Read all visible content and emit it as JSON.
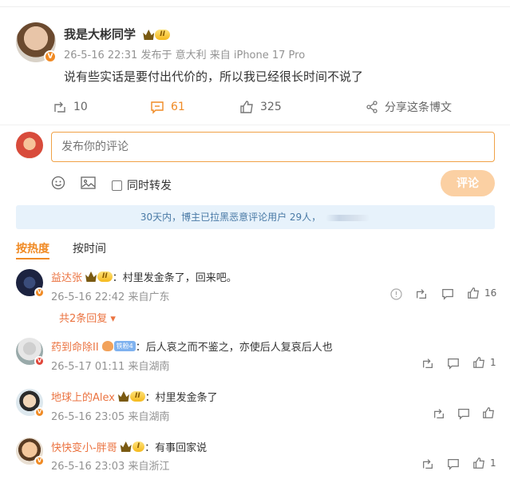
{
  "post": {
    "author": "我是大彬同学",
    "level": "II",
    "meta": "26-5-16 22:31  发布于 意大利  来自 iPhone 17 Pro",
    "text": "说有些实话是要付出代价的，所以我已经很长时间不说了",
    "reposts": "10",
    "comments": "61",
    "likes": "325",
    "share_label": "分享这条博文"
  },
  "compose": {
    "placeholder": "发布你的评论",
    "repost_label": "同时转发",
    "submit_label": "评论"
  },
  "notice": "30天内，博主已拉黑恶意评论用户 29人，",
  "sort": {
    "hot": "按热度",
    "time": "按时间"
  },
  "comments": [
    {
      "user": "益达张",
      "level": "II",
      "text": "：村里发金条了，回来吧。",
      "meta": "26-5-16 22:42  来自广东",
      "likes": "16",
      "replies": "共2条回复"
    },
    {
      "user": "药到命除II",
      "fan_level": "铁粉4",
      "text": "：后人哀之而不鉴之，亦使后人复哀后人也",
      "meta": "26-5-17 01:11  来自湖南",
      "likes": "1"
    },
    {
      "user": "地球上的Alex",
      "level": "II",
      "text": "：村里发金条了",
      "meta": "26-5-16 23:05  来自湖南",
      "likes": ""
    },
    {
      "user": "快快变小-胖哥",
      "level": "I",
      "text": "：有事回家说",
      "meta": "26-5-16 23:03  来自浙江",
      "likes": "1"
    }
  ],
  "colors": {
    "accent": "#f08a24",
    "username": "#eb7340",
    "notice_bg": "#e7f2fb"
  }
}
